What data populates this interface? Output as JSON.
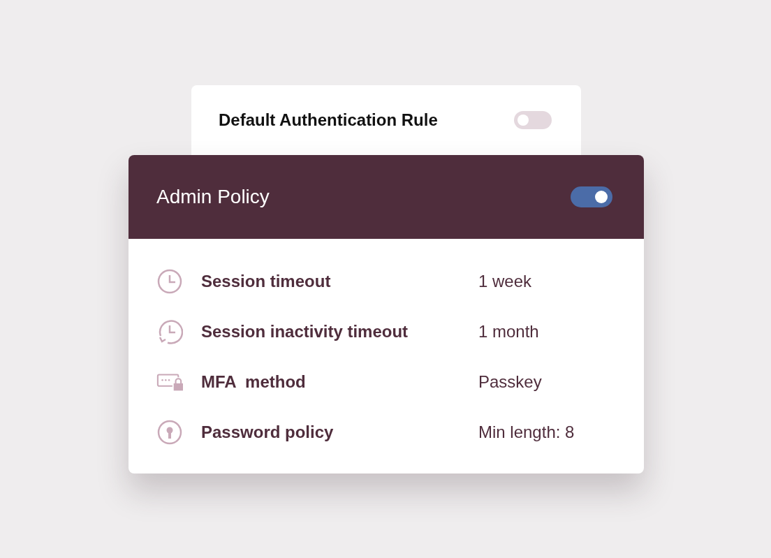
{
  "back_card": {
    "title": "Default Authentication Rule",
    "on": false
  },
  "policy_card": {
    "title": "Admin Policy",
    "on": true,
    "rows": [
      {
        "label": "Session timeout",
        "value": "1 week"
      },
      {
        "label": "Session inactivity timeout",
        "value": "1 month"
      },
      {
        "label": "MFA  method",
        "value": "Passkey"
      },
      {
        "label": "Password policy",
        "value": "Min length: 8"
      }
    ]
  }
}
